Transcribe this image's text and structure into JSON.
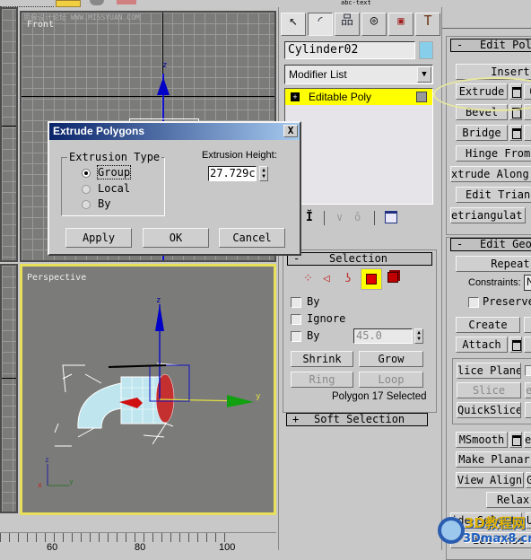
{
  "toolbar": {
    "items": [
      "select-icon",
      "select-region-icon",
      "render-icon",
      "align-icon",
      "material-icon",
      "abc-text"
    ]
  },
  "viewports": {
    "front": {
      "label": "Front"
    },
    "perspective": {
      "label": "Perspective",
      "axes": {
        "x": "x",
        "y": "y",
        "z": "z"
      }
    }
  },
  "watermark_top": "思缘设计论坛 WWW.MISSYUAN.COM",
  "timeline": {
    "ticks": [
      "60",
      "80",
      "100"
    ]
  },
  "command_panel": {
    "tabs": [
      "create",
      "modify",
      "hierarchy",
      "motion",
      "display",
      "utilities"
    ],
    "object_name": "Cylinder02",
    "object_color": "#87ceeb",
    "modifier_list": "Modifier List",
    "stack": [
      {
        "label": "Editable Poly",
        "expand": "+"
      }
    ],
    "stack_icons": [
      "pin-stack",
      "show-end-result",
      "make-unique",
      "remove-modifier",
      "configure-modifier-sets"
    ]
  },
  "selection_rollout": {
    "title": "Selection",
    "collapse": "-",
    "levels": [
      "vertex",
      "edge",
      "border",
      "polygon",
      "element"
    ],
    "active_level": "polygon",
    "checkboxes": [
      {
        "label": "By",
        "checked": false
      },
      {
        "label": "Ignore",
        "checked": false
      },
      {
        "label": "By",
        "checked": false
      }
    ],
    "angle_value": "45.0",
    "buttons": {
      "shrink": "Shrink",
      "grow": "Grow",
      "ring": "Ring",
      "loop": "Loop"
    },
    "status": "Polygon 17 Selected"
  },
  "soft_selection": {
    "title": "Soft Selection",
    "expand": "+"
  },
  "edit_polygons": {
    "title": "Edit Pol",
    "collapse": "-",
    "buttons": [
      "Insert V",
      "Extrude",
      "Bevel",
      "Bridge",
      "Hinge From",
      "xtrude Along",
      "Edit Triang",
      "etriangulat"
    ]
  },
  "edit_geometry": {
    "title": "Edit Geo",
    "collapse": "-",
    "repeat": "Repeat L",
    "constraints_label": "Constraints:",
    "constraints_value": "N",
    "preserve": "Preserve",
    "buttons": [
      "Create",
      "Attach",
      "lice Plane",
      "Slice",
      "QuickSlice",
      "MSmooth",
      "Make Planar",
      "View Align",
      "Relax",
      "ide Selecte",
      "ide Unse"
    ],
    "side_buttons": [
      "e",
      "G",
      "U",
      "e"
    ]
  },
  "dialog": {
    "title": "Extrude Polygons",
    "close": "X",
    "group_label": "Extrusion Type",
    "options": [
      {
        "label": "Group",
        "selected": true
      },
      {
        "label": "Local",
        "selected": false
      },
      {
        "label": "By",
        "selected": false
      }
    ],
    "height_label": "Extrusion Height:",
    "height_value": "27.729c",
    "buttons": {
      "apply": "Apply",
      "ok": "OK",
      "cancel": "Cancel"
    }
  },
  "watermark_bottom": {
    "line1": "3D教程网",
    "line2": "3Dmax8.cn"
  },
  "colors": {
    "highlight_yellow": "#ffff00",
    "dialog_title": "#0a246a",
    "viewport_active": "#e8e05a"
  }
}
